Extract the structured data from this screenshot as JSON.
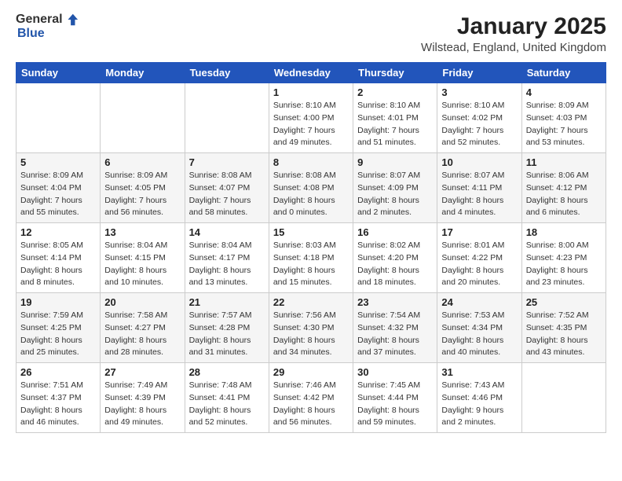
{
  "header": {
    "logo_general": "General",
    "logo_blue": "Blue",
    "title": "January 2025",
    "subtitle": "Wilstead, England, United Kingdom"
  },
  "columns": [
    "Sunday",
    "Monday",
    "Tuesday",
    "Wednesday",
    "Thursday",
    "Friday",
    "Saturday"
  ],
  "weeks": [
    [
      {
        "day": "",
        "detail": ""
      },
      {
        "day": "",
        "detail": ""
      },
      {
        "day": "",
        "detail": ""
      },
      {
        "day": "1",
        "detail": "Sunrise: 8:10 AM\nSunset: 4:00 PM\nDaylight: 7 hours\nand 49 minutes."
      },
      {
        "day": "2",
        "detail": "Sunrise: 8:10 AM\nSunset: 4:01 PM\nDaylight: 7 hours\nand 51 minutes."
      },
      {
        "day": "3",
        "detail": "Sunrise: 8:10 AM\nSunset: 4:02 PM\nDaylight: 7 hours\nand 52 minutes."
      },
      {
        "day": "4",
        "detail": "Sunrise: 8:09 AM\nSunset: 4:03 PM\nDaylight: 7 hours\nand 53 minutes."
      }
    ],
    [
      {
        "day": "5",
        "detail": "Sunrise: 8:09 AM\nSunset: 4:04 PM\nDaylight: 7 hours\nand 55 minutes."
      },
      {
        "day": "6",
        "detail": "Sunrise: 8:09 AM\nSunset: 4:05 PM\nDaylight: 7 hours\nand 56 minutes."
      },
      {
        "day": "7",
        "detail": "Sunrise: 8:08 AM\nSunset: 4:07 PM\nDaylight: 7 hours\nand 58 minutes."
      },
      {
        "day": "8",
        "detail": "Sunrise: 8:08 AM\nSunset: 4:08 PM\nDaylight: 8 hours\nand 0 minutes."
      },
      {
        "day": "9",
        "detail": "Sunrise: 8:07 AM\nSunset: 4:09 PM\nDaylight: 8 hours\nand 2 minutes."
      },
      {
        "day": "10",
        "detail": "Sunrise: 8:07 AM\nSunset: 4:11 PM\nDaylight: 8 hours\nand 4 minutes."
      },
      {
        "day": "11",
        "detail": "Sunrise: 8:06 AM\nSunset: 4:12 PM\nDaylight: 8 hours\nand 6 minutes."
      }
    ],
    [
      {
        "day": "12",
        "detail": "Sunrise: 8:05 AM\nSunset: 4:14 PM\nDaylight: 8 hours\nand 8 minutes."
      },
      {
        "day": "13",
        "detail": "Sunrise: 8:04 AM\nSunset: 4:15 PM\nDaylight: 8 hours\nand 10 minutes."
      },
      {
        "day": "14",
        "detail": "Sunrise: 8:04 AM\nSunset: 4:17 PM\nDaylight: 8 hours\nand 13 minutes."
      },
      {
        "day": "15",
        "detail": "Sunrise: 8:03 AM\nSunset: 4:18 PM\nDaylight: 8 hours\nand 15 minutes."
      },
      {
        "day": "16",
        "detail": "Sunrise: 8:02 AM\nSunset: 4:20 PM\nDaylight: 8 hours\nand 18 minutes."
      },
      {
        "day": "17",
        "detail": "Sunrise: 8:01 AM\nSunset: 4:22 PM\nDaylight: 8 hours\nand 20 minutes."
      },
      {
        "day": "18",
        "detail": "Sunrise: 8:00 AM\nSunset: 4:23 PM\nDaylight: 8 hours\nand 23 minutes."
      }
    ],
    [
      {
        "day": "19",
        "detail": "Sunrise: 7:59 AM\nSunset: 4:25 PM\nDaylight: 8 hours\nand 25 minutes."
      },
      {
        "day": "20",
        "detail": "Sunrise: 7:58 AM\nSunset: 4:27 PM\nDaylight: 8 hours\nand 28 minutes."
      },
      {
        "day": "21",
        "detail": "Sunrise: 7:57 AM\nSunset: 4:28 PM\nDaylight: 8 hours\nand 31 minutes."
      },
      {
        "day": "22",
        "detail": "Sunrise: 7:56 AM\nSunset: 4:30 PM\nDaylight: 8 hours\nand 34 minutes."
      },
      {
        "day": "23",
        "detail": "Sunrise: 7:54 AM\nSunset: 4:32 PM\nDaylight: 8 hours\nand 37 minutes."
      },
      {
        "day": "24",
        "detail": "Sunrise: 7:53 AM\nSunset: 4:34 PM\nDaylight: 8 hours\nand 40 minutes."
      },
      {
        "day": "25",
        "detail": "Sunrise: 7:52 AM\nSunset: 4:35 PM\nDaylight: 8 hours\nand 43 minutes."
      }
    ],
    [
      {
        "day": "26",
        "detail": "Sunrise: 7:51 AM\nSunset: 4:37 PM\nDaylight: 8 hours\nand 46 minutes."
      },
      {
        "day": "27",
        "detail": "Sunrise: 7:49 AM\nSunset: 4:39 PM\nDaylight: 8 hours\nand 49 minutes."
      },
      {
        "day": "28",
        "detail": "Sunrise: 7:48 AM\nSunset: 4:41 PM\nDaylight: 8 hours\nand 52 minutes."
      },
      {
        "day": "29",
        "detail": "Sunrise: 7:46 AM\nSunset: 4:42 PM\nDaylight: 8 hours\nand 56 minutes."
      },
      {
        "day": "30",
        "detail": "Sunrise: 7:45 AM\nSunset: 4:44 PM\nDaylight: 8 hours\nand 59 minutes."
      },
      {
        "day": "31",
        "detail": "Sunrise: 7:43 AM\nSunset: 4:46 PM\nDaylight: 9 hours\nand 2 minutes."
      },
      {
        "day": "",
        "detail": ""
      }
    ]
  ]
}
